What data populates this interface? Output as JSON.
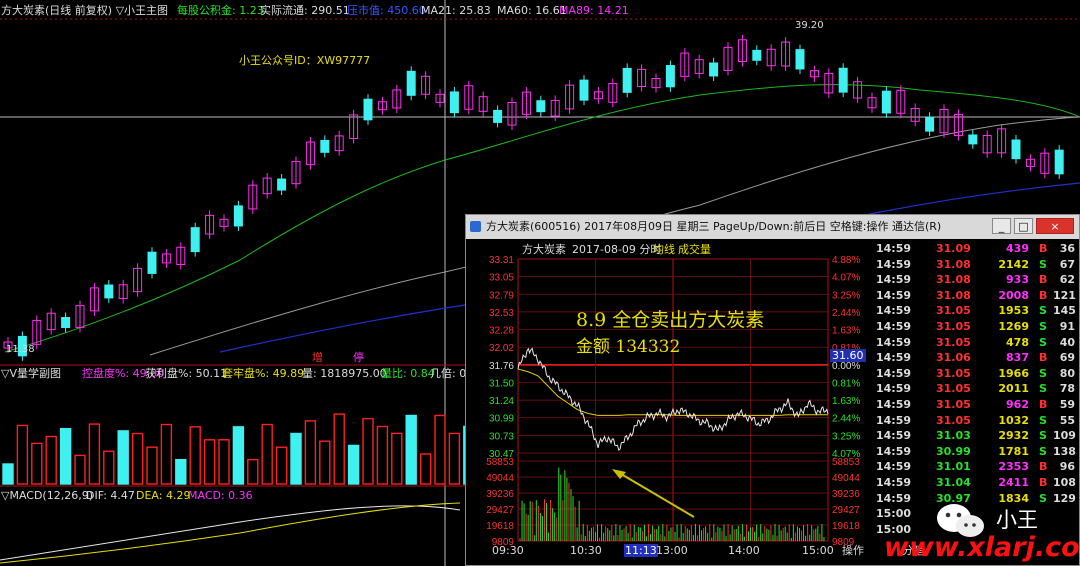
{
  "main": {
    "header": {
      "title": "方大炭素(日线 前复权) ▽小王主图",
      "item1": "每股公积金: 1.23",
      "item2": "实际流通: 290.51",
      "item3": "压市值: 450.60",
      "item4": "MA21: 25.83",
      "item5": "MA60: 16.61",
      "item6": "MA89: 14.21"
    },
    "annotation": "小王公众号ID：XW97777",
    "high_label": "39.20",
    "low_label": "11.38",
    "zeng_label": "增",
    "ting_label": "停",
    "vol_header": {
      "title": "▽V量学副图",
      "item1": "控盘度%: 49.00",
      "item2": "获利盘%: 50.11",
      "item3": "套牢盘%: 49.89",
      "item4": "量: 1818975.00",
      "item5": "量比: 0.84",
      "item6": "几倍: 0"
    },
    "macd_header": {
      "title": "▽MACD(12,26,9)",
      "dif": "DIF: 4.47",
      "dea": "DEA: 4.29",
      "macd": "MACD: 0.36"
    }
  },
  "popup": {
    "title": "方大炭素(600516) 2017年08月09日 星期三 PageUp/Down:前后日 空格键:操作 通达信(R)",
    "btn_minimize": "_",
    "btn_maximize": "□",
    "btn_close": "×",
    "chart_header": {
      "name": "方大炭素",
      "date": "2017-08-09 分时",
      "avg": "均线",
      "vol": "成交量"
    },
    "annotation_line1": "8.9 全仓卖出方大炭素",
    "annotation_line2": "金额 134332",
    "current_price_label": "31.60",
    "time_labels": [
      "09:30",
      "10:30",
      "11:13",
      "13:00",
      "14:00",
      "15:00"
    ],
    "bottom_tabs": [
      "操作",
      "分笔"
    ]
  },
  "chart_data": {
    "type": "line",
    "title": "方大炭素 2017-08-09 分时",
    "price_axis": [
      "33.31",
      "33.05",
      "32.79",
      "32.53",
      "32.28",
      "32.02",
      "31.76",
      "31.50",
      "31.24",
      "30.99",
      "30.73",
      "30.47"
    ],
    "pct_axis": [
      "4.88%",
      "4.07%",
      "3.25%",
      "2.44%",
      "1.63%",
      "0.81%",
      "0.00%",
      "0.81%",
      "1.63%",
      "2.44%",
      "3.25%",
      "4.07%"
    ],
    "volume_axis": [
      "58853",
      "49044",
      "39236",
      "29427",
      "19618",
      "9809"
    ],
    "x_ticks": [
      "09:30",
      "10:30",
      "11:13",
      "13:00",
      "14:00",
      "15:00"
    ],
    "ylim": [
      30.47,
      33.31
    ],
    "prev_close": 31.76,
    "series": [
      {
        "name": "price",
        "values": [
          31.7,
          32.0,
          31.85,
          31.6,
          31.45,
          31.3,
          31.15,
          30.9,
          30.6,
          30.7,
          30.55,
          30.7,
          30.9,
          31.0,
          31.05,
          31.0,
          31.1,
          31.05,
          30.95,
          30.9,
          30.8,
          30.95,
          31.05,
          31.0,
          30.9,
          30.95,
          31.1,
          31.2,
          31.0,
          31.2,
          31.08,
          31.09
        ]
      },
      {
        "name": "average",
        "values": [
          31.7,
          31.66,
          31.6,
          31.45,
          31.3,
          31.2,
          31.1,
          31.05,
          31.02,
          31.02,
          31.02,
          31.03,
          31.03,
          31.03,
          31.03,
          31.03,
          31.02,
          31.02,
          31.02,
          31.02,
          31.02,
          31.02,
          31.02,
          31.02,
          31.02,
          31.02,
          31.02,
          31.03,
          31.03,
          31.03,
          31.03,
          31.03
        ]
      }
    ]
  },
  "trades": [
    {
      "time": "14:59",
      "price": "31.09",
      "vol": "439",
      "bs": "B",
      "n": "36"
    },
    {
      "time": "14:59",
      "price": "31.08",
      "vol": "2142",
      "bs": "S",
      "n": "67"
    },
    {
      "time": "14:59",
      "price": "31.08",
      "vol": "933",
      "bs": "B",
      "n": "62"
    },
    {
      "time": "14:59",
      "price": "31.08",
      "vol": "2008",
      "bs": "B",
      "n": "121"
    },
    {
      "time": "14:59",
      "price": "31.05",
      "vol": "1953",
      "bs": "S",
      "n": "145"
    },
    {
      "time": "14:59",
      "price": "31.05",
      "vol": "1269",
      "bs": "S",
      "n": "91"
    },
    {
      "time": "14:59",
      "price": "31.05",
      "vol": "478",
      "bs": "S",
      "n": "40"
    },
    {
      "time": "14:59",
      "price": "31.06",
      "vol": "837",
      "bs": "B",
      "n": "69"
    },
    {
      "time": "14:59",
      "price": "31.05",
      "vol": "1966",
      "bs": "S",
      "n": "80"
    },
    {
      "time": "14:59",
      "price": "31.05",
      "vol": "2011",
      "bs": "S",
      "n": "78"
    },
    {
      "time": "14:59",
      "price": "31.05",
      "vol": "962",
      "bs": "B",
      "n": "59"
    },
    {
      "time": "14:59",
      "price": "31.05",
      "vol": "1032",
      "bs": "S",
      "n": "55"
    },
    {
      "time": "14:59",
      "price": "31.03",
      "vol": "2932",
      "bs": "S",
      "n": "109"
    },
    {
      "time": "14:59",
      "price": "30.99",
      "vol": "1781",
      "bs": "S",
      "n": "138"
    },
    {
      "time": "14:59",
      "price": "31.01",
      "vol": "2353",
      "bs": "B",
      "n": "96"
    },
    {
      "time": "14:59",
      "price": "31.04",
      "vol": "2411",
      "bs": "B",
      "n": "108"
    },
    {
      "time": "14:59",
      "price": "30.97",
      "vol": "1834",
      "bs": "S",
      "n": "129"
    },
    {
      "time": "15:00",
      "price": "",
      "vol": "",
      "bs": "",
      "n": ""
    },
    {
      "time": "15:00",
      "price": "",
      "vol": "",
      "bs": "",
      "n": ""
    }
  ],
  "watermark": {
    "name": "小王",
    "url": "www.xlarj.com"
  },
  "colors": {
    "up": "#ff2ef0",
    "down": "#3ef0f0",
    "ma_green": "#1db81d",
    "ma_white": "#9a9a9a",
    "ma_blue": "#2030d0"
  }
}
